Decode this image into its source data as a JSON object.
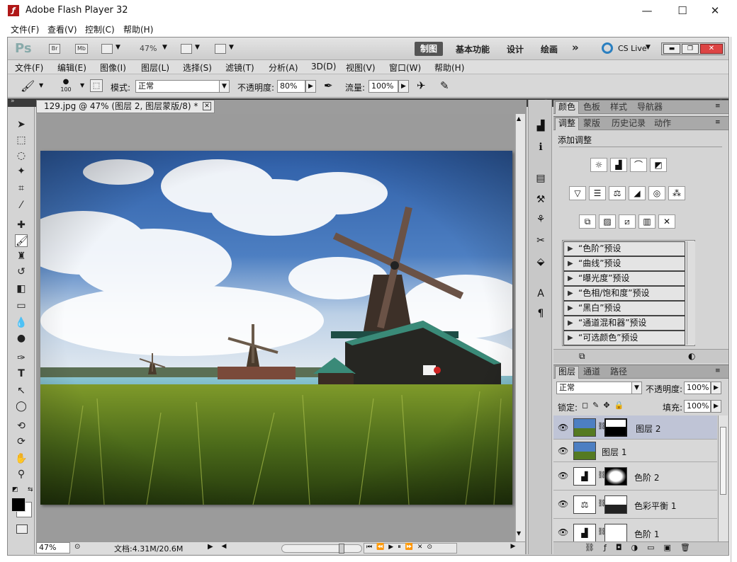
{
  "window": {
    "title": "Adobe Flash Player 32",
    "app_icon": "flash-icon",
    "minimize": "—",
    "maximize": "☐",
    "close": "✕"
  },
  "flash_menu": [
    "文件(F)",
    "查看(V)",
    "控制(C)",
    "帮助(H)"
  ],
  "ps_app": {
    "logo": "Ps",
    "br": "Br",
    "mb": "Mb",
    "zoom": "47%",
    "workspaces": [
      "制图",
      "基本功能",
      "设计",
      "绘画"
    ],
    "more": "»",
    "cslive": "CS Live"
  },
  "ps_menu": [
    "文件(F)",
    "编辑(E)",
    "图像(I)",
    "图层(L)",
    "选择(S)",
    "滤镜(T)",
    "分析(A)",
    "3D(D)",
    "视图(V)",
    "窗口(W)",
    "帮助(H)"
  ],
  "options": {
    "brush_size": "100",
    "mode_label": "模式:",
    "mode_value": "正常",
    "opacity_label": "不透明度:",
    "opacity_value": "80%",
    "flow_label": "流量:",
    "flow_value": "100%"
  },
  "document": {
    "tab_title": "129.jpg @ 47% (图层 2, 图层蒙版/8) *",
    "zoom": "47%",
    "doc_info": "文档:4.31M/20.6M"
  },
  "panels": {
    "top_tabs": [
      "颜色",
      "色板",
      "样式",
      "导航器"
    ],
    "adj_tabs": [
      "调整",
      "蒙版",
      "历史记录",
      "动作"
    ],
    "adj_title": "添加调整",
    "presets": [
      "“色阶”预设",
      "“曲线”预设",
      "“曝光度”预设",
      "“色相/饱和度”预设",
      "“黑白”预设",
      "“通道混和器”预设",
      "“可选颜色”预设"
    ],
    "layer_tabs": [
      "图层",
      "通道",
      "路径"
    ],
    "blend_mode": "正常",
    "opacity_label": "不透明度:",
    "opacity_value": "100%",
    "lock_label": "锁定:",
    "fill_label": "填充:",
    "fill_value": "100%",
    "layers": [
      "图层 2",
      "图层 1",
      "色阶 2",
      "色彩平衡 1",
      "色阶 1"
    ]
  },
  "colors": {
    "selected_layer": "#bfc4d6",
    "ps_bg": "#d6d6d6",
    "dark_strip": "#3b3b3b"
  }
}
